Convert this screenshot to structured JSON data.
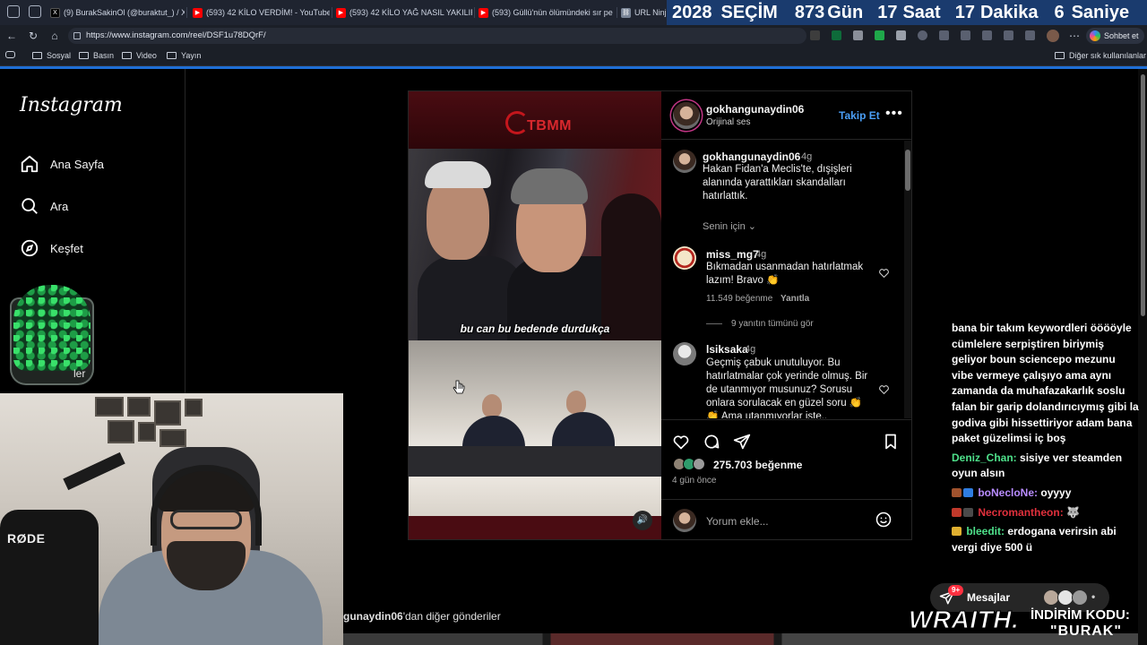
{
  "browser": {
    "tabs": [
      {
        "label": "(9) BurakSakinOl (@buraktut_) / X",
        "favicon": "x-icon",
        "color": "#000000"
      },
      {
        "label": "(593) 42 KİLO VERDİM! - YouTube",
        "favicon": "youtube-icon",
        "color": "#ff0000"
      },
      {
        "label": "(593) 42 KİLO YAĞ NASIL YAKILIR",
        "favicon": "youtube-icon",
        "color": "#ff0000"
      },
      {
        "label": "(593) Güllü'nün ölümündeki sır pe",
        "favicon": "youtube-icon",
        "color": "#ff0000"
      },
      {
        "label": "URL Ninja",
        "favicon": "link-icon",
        "color": "#7a8597"
      }
    ],
    "url": "https://www.instagram.com/reel/DSF1u78DQrF/",
    "copilot_label": "Sohbet et",
    "bookmarks": [
      "Sosyal",
      "Basın",
      "Video",
      "Yayın"
    ],
    "other_bookmarks": "Diğer sık kullanılanlar"
  },
  "countdown": {
    "year": "2028",
    "label": "SEÇİM",
    "days": "873",
    "days_unit": "Gün",
    "hours": "17",
    "hours_unit": "Saat",
    "minutes": "17",
    "minutes_unit": "Dakika",
    "seconds": "6",
    "seconds_unit": "Saniye"
  },
  "instagram": {
    "logo": "Instagram",
    "nav": [
      {
        "label": "Ana Sayfa",
        "icon": "home-icon"
      },
      {
        "label": "Ara",
        "icon": "search-icon"
      },
      {
        "label": "Keşfet",
        "icon": "compass-icon"
      }
    ],
    "post": {
      "username": "gokhangunaydin06",
      "audio": "Orijinal ses",
      "follow": "Takip Et",
      "video_brand": "TBMM",
      "video_caption": "bu can bu bedende durdukça",
      "caption": {
        "username": "gokhangunaydin06",
        "age": "4g",
        "text": "Hakan Fidan'a Meclis'te, dışişleri alanında yarattıkları skandalları hatırlattık."
      },
      "for_you": "Senin için",
      "comments": [
        {
          "username": "miss_mg7",
          "age": "4g",
          "text": "Bıkmadan usanmadan hatırlatmak lazım! Bravo 👏",
          "likes": "11.549 beğenme",
          "reply": "Yanıtla",
          "view_replies": "9 yanıtın tümünü gör"
        },
        {
          "username": "lsiksaka",
          "age": "4g",
          "text": "Geçmiş çabuk unutuluyor. Bu hatırlatmalar çok yerinde olmuş. Bir de utanmıyor musunuz? Sorusu onlara sorulacak en güzel soru 👏 👏 Ama utanmıyorlar işte.."
        }
      ],
      "likes": "275.703 beğenme",
      "time_ago": "4 gün önce",
      "comment_placeholder": "Yorum ekle...",
      "more_posts_user": "gunaydin06",
      "more_posts_suffix": "'dan diğer gönderiler"
    },
    "messages": {
      "label": "Mesajlar",
      "count": "9+"
    }
  },
  "stream": {
    "mic_brand": "RØDE",
    "jar_partial_label": "ler",
    "chat": [
      {
        "user": "",
        "text": "bana bir takım keywordleri ööööyle cümlelere serpiştiren biriymiş geliyor boun sciencepo mezunu vibe vermeye çalışıyo ama aynı zamanda da muhafazakarlık soslu falan bir garip dolandırıcıymış gibi la godiva gibi hissettiriyor adam bana paket güzelimsi iç boş",
        "color": "#ffffff",
        "badge": ""
      },
      {
        "user": "Deniz_Chan:",
        "text": "sisiye ver steamden oyun alsın",
        "color": "#4ee08a",
        "badge": ""
      },
      {
        "user": "boNecloNe:",
        "text": "oyyyy",
        "color": "#b98cff",
        "badge": "#a0522d"
      },
      {
        "user": "Necromantheon:",
        "text": "🐺",
        "color": "#e0303c",
        "badge": "#c0392b"
      },
      {
        "user": "bleedit:",
        "text": "erdogana verirsin abi vergi diye 500 ü",
        "color": "#4ee08a",
        "badge": "#e0b030"
      }
    ],
    "sponsor": {
      "brand": "WRAITH.",
      "code_label": "İNDİRİM KODU:",
      "code": "\"BURAK\""
    }
  }
}
